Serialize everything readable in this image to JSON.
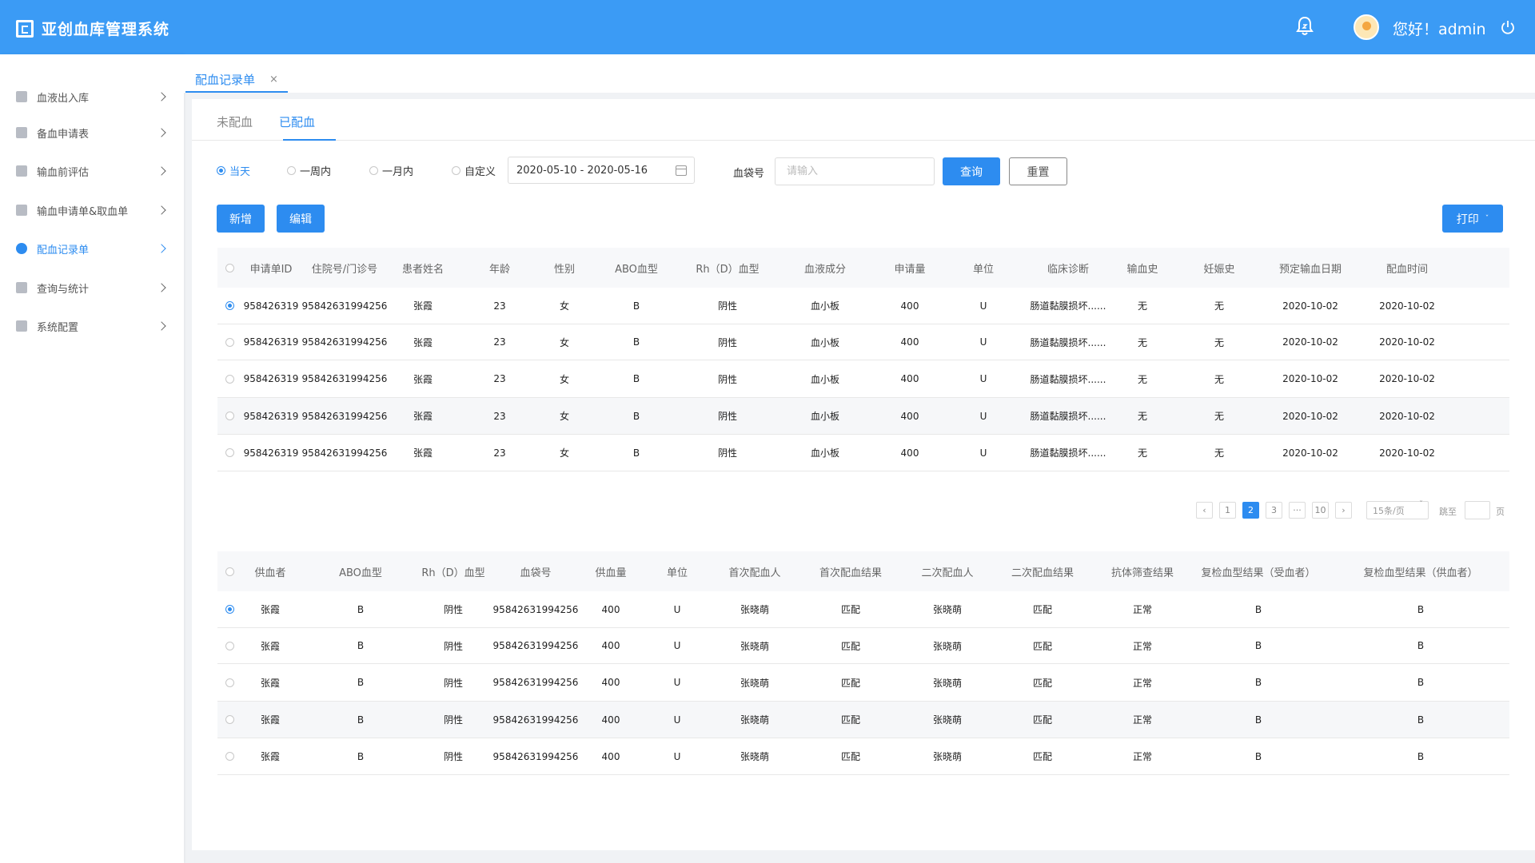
{
  "app": {
    "title": "亚创血库管理系统",
    "greeting": "您好！admin"
  },
  "sidebar": {
    "items": [
      {
        "label": "血液出入库",
        "icon": "download-icon"
      },
      {
        "label": "备血申请表",
        "icon": "clipboard-icon"
      },
      {
        "label": "输血前评估",
        "icon": "chart-icon"
      },
      {
        "label": "输血申请单&取血单",
        "icon": "document-icon"
      },
      {
        "label": "配血记录单",
        "icon": "circle-icon",
        "active": true
      },
      {
        "label": "查询与统计",
        "icon": "pie-icon"
      },
      {
        "label": "系统配置",
        "icon": "gear-icon"
      }
    ]
  },
  "page_tab": {
    "label": "配血记录单",
    "close": "×"
  },
  "subtabs": [
    "未配血",
    "已配血"
  ],
  "filters": {
    "ranges": [
      "当天",
      "一周内",
      "一月内",
      "自定义"
    ],
    "selected_range": "当天",
    "date_range": "2020-05-10 -  2020-05-16",
    "bag_label": "血袋号",
    "bag_placeholder": "请输入",
    "query": "查询",
    "reset": "重置"
  },
  "actions": {
    "add": "新增",
    "edit": "编辑",
    "print": "打印"
  },
  "table1": {
    "headers": [
      "申请单ID",
      "住院号/门诊号",
      "患者姓名",
      "年龄",
      "性别",
      "ABO血型",
      "Rh（D）血型",
      "血液成分",
      "申请量",
      "单位",
      "临床诊断",
      "输血史",
      "妊娠史",
      "预定输血日期",
      "配血时间"
    ],
    "rows": [
      [
        "958426319",
        "95842631994256",
        "张霞",
        "23",
        "女",
        "B",
        "阴性",
        "血小板",
        "400",
        "U",
        "肠道黏膜损坏......",
        "无",
        "无",
        "2020-10-02",
        "2020-10-02"
      ],
      [
        "958426319",
        "95842631994256",
        "张霞",
        "23",
        "女",
        "B",
        "阴性",
        "血小板",
        "400",
        "U",
        "肠道黏膜损坏......",
        "无",
        "无",
        "2020-10-02",
        "2020-10-02"
      ],
      [
        "958426319",
        "95842631994256",
        "张霞",
        "23",
        "女",
        "B",
        "阴性",
        "血小板",
        "400",
        "U",
        "肠道黏膜损坏......",
        "无",
        "无",
        "2020-10-02",
        "2020-10-02"
      ],
      [
        "958426319",
        "95842631994256",
        "张霞",
        "23",
        "女",
        "B",
        "阴性",
        "血小板",
        "400",
        "U",
        "肠道黏膜损坏......",
        "无",
        "无",
        "2020-10-02",
        "2020-10-02"
      ],
      [
        "958426319",
        "95842631994256",
        "张霞",
        "23",
        "女",
        "B",
        "阴性",
        "血小板",
        "400",
        "U",
        "肠道黏膜损坏......",
        "无",
        "无",
        "2020-10-02",
        "2020-10-02"
      ]
    ],
    "selected_row": 0
  },
  "pagination": {
    "pages": [
      "1",
      "2",
      "3",
      "···",
      "10"
    ],
    "current": "2",
    "page_size": "15条/页",
    "jump_label": "跳至",
    "page_suffix": "页"
  },
  "table2": {
    "headers": [
      "供血者",
      "ABO血型",
      "Rh（D）血型",
      "血袋号",
      "供血量",
      "单位",
      "首次配血人",
      "首次配血结果",
      "二次配血人",
      "二次配血结果",
      "抗体筛查结果",
      "复检血型结果（受血者）",
      "复检血型结果（供血者）"
    ],
    "rows": [
      [
        "张霞",
        "B",
        "阴性",
        "95842631994256",
        "400",
        "U",
        "张晓萌",
        "匹配",
        "张晓萌",
        "匹配",
        "正常",
        "B",
        "B"
      ],
      [
        "张霞",
        "B",
        "阴性",
        "95842631994256",
        "400",
        "U",
        "张晓萌",
        "匹配",
        "张晓萌",
        "匹配",
        "正常",
        "B",
        "B"
      ],
      [
        "张霞",
        "B",
        "阴性",
        "95842631994256",
        "400",
        "U",
        "张晓萌",
        "匹配",
        "张晓萌",
        "匹配",
        "正常",
        "B",
        "B"
      ],
      [
        "张霞",
        "B",
        "阴性",
        "95842631994256",
        "400",
        "U",
        "张晓萌",
        "匹配",
        "张晓萌",
        "匹配",
        "正常",
        "B",
        "B"
      ],
      [
        "张霞",
        "B",
        "阴性",
        "95842631994256",
        "400",
        "U",
        "张晓萌",
        "匹配",
        "张晓萌",
        "匹配",
        "正常",
        "B",
        "B"
      ]
    ],
    "selected_row": 0
  }
}
